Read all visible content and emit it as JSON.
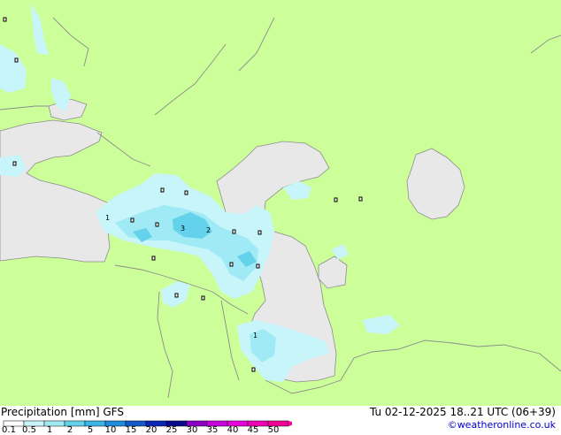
{
  "title": "Precipitation [mm] GFS",
  "valid_time": "Tu 02-12-2025 18..21 UTC (06+39)",
  "credit": "©weatheronline.co.uk",
  "legend": {
    "labels": [
      "0.1",
      "0.5",
      "1",
      "2",
      "5",
      "10",
      "15",
      "20",
      "25",
      "30",
      "35",
      "40",
      "45",
      "50"
    ],
    "colors": [
      "#ffffff",
      "#c8f5fa",
      "#a0eaf5",
      "#64d2eb",
      "#3cb4e6",
      "#1e8cdc",
      "#145ac8",
      "#0a28b4",
      "#0a0a8c",
      "#8c00c8",
      "#c800dc",
      "#e600dc",
      "#f000b4",
      "#f00096"
    ]
  },
  "colors": {
    "land": "#ccff99",
    "sea": "#e8e8e8",
    "border": "#8c8c8c",
    "precip_light": "#c8f5fa",
    "precip_mid": "#a0eaf5",
    "precip_heavy": "#64d2eb"
  },
  "point_labels": [
    {
      "id": "p1",
      "text": "1"
    },
    {
      "id": "p3",
      "text": "3"
    },
    {
      "id": "p2",
      "text": "2"
    },
    {
      "id": "p1b",
      "text": "1"
    }
  ]
}
